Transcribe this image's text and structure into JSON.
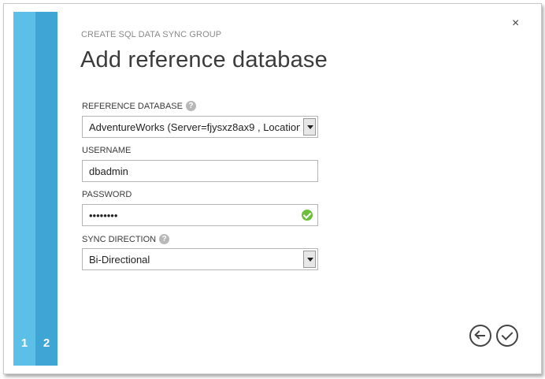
{
  "dialog": {
    "eyebrow": "CREATE SQL DATA SYNC GROUP",
    "title": "Add reference database",
    "close_glyph": "×"
  },
  "steps": [
    {
      "number": "1"
    },
    {
      "number": "2"
    }
  ],
  "form": {
    "reference_database": {
      "label": "REFERENCE DATABASE",
      "help_glyph": "?",
      "value": "AdventureWorks (Server=fjysxz8ax9 , Location"
    },
    "username": {
      "label": "USERNAME",
      "value": "dbadmin"
    },
    "password": {
      "label": "PASSWORD",
      "value": "••••••••",
      "status_icon": "check-icon"
    },
    "sync_direction": {
      "label": "SYNC DIRECTION",
      "help_glyph": "?",
      "value": "Bi-Directional"
    }
  },
  "footer": {
    "back_icon": "arrow-left-icon",
    "ok_icon": "check-icon"
  },
  "colors": {
    "step1": "#5bbfe7",
    "step2": "#3ea5d5",
    "success": "#6cbf3a"
  }
}
